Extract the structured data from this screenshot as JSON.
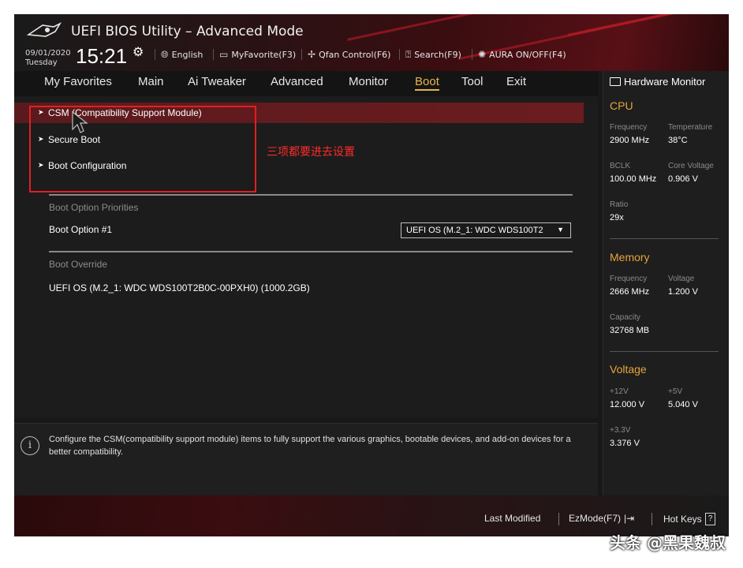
{
  "header": {
    "title": "UEFI BIOS Utility – Advanced Mode",
    "date": "09/01/2020",
    "weekday": "Tuesday",
    "time": "15:21",
    "items": [
      {
        "label": "English",
        "icon": "globe-icon"
      },
      {
        "label": "MyFavorite(F3)",
        "icon": "favorite-folder-icon"
      },
      {
        "label": "Qfan Control(F6)",
        "icon": "fan-icon"
      },
      {
        "label": "Search(F9)",
        "icon": "search-box-icon"
      },
      {
        "label": "AURA ON/OFF(F4)",
        "icon": "aura-icon"
      }
    ]
  },
  "nav": {
    "tabs": [
      "My Favorites",
      "Main",
      "Ai Tweaker",
      "Advanced",
      "Monitor",
      "Boot",
      "Tool",
      "Exit"
    ],
    "active": "Boot"
  },
  "main": {
    "menu": [
      "CSM (Compatibility Support Module)",
      "Secure Boot",
      "Boot Configuration"
    ],
    "annotation": "三项都要进去设置",
    "boot_priorities_label": "Boot Option Priorities",
    "boot_option_label": "Boot Option #1",
    "boot_option_value": "UEFI OS (M.2_1: WDC WDS100T2",
    "boot_override_label": "Boot Override",
    "boot_override_item": "UEFI OS (M.2_1: WDC WDS100T2B0C-00PXH0) (1000.2GB)"
  },
  "help": {
    "text": "Configure the CSM(compatibility support module) items to fully support the various graphics, bootable devices, and add-on devices for a better compatibility."
  },
  "hw": {
    "title": "Hardware Monitor",
    "cpu": {
      "heading": "CPU",
      "frequency_label": "Frequency",
      "frequency": "2900 MHz",
      "temperature_label": "Temperature",
      "temperature": "38°C",
      "bclk_label": "BCLK",
      "bclk": "100.00 MHz",
      "core_voltage_label": "Core Voltage",
      "core_voltage": "0.906 V",
      "ratio_label": "Ratio",
      "ratio": "29x"
    },
    "memory": {
      "heading": "Memory",
      "frequency_label": "Frequency",
      "frequency": "2666 MHz",
      "voltage_label": "Voltage",
      "voltage": "1.200 V",
      "capacity_label": "Capacity",
      "capacity": "32768 MB"
    },
    "voltage": {
      "heading": "Voltage",
      "v12_label": "+12V",
      "v12": "12.000 V",
      "v5_label": "+5V",
      "v5": "5.040 V",
      "v33_label": "+3.3V",
      "v33": "3.376 V"
    }
  },
  "footer": {
    "last_modified": "Last Modified",
    "ezmode": "EzMode(F7)",
    "hotkeys": "Hot Keys",
    "hotkeys_key": "?"
  },
  "watermark": "头条 @黑果魏叔",
  "colors": {
    "accent": "#e8b44a",
    "selected_row": "#6b1c1f",
    "annotation": "#e02020",
    "hw_heading": "#e5a43b"
  }
}
